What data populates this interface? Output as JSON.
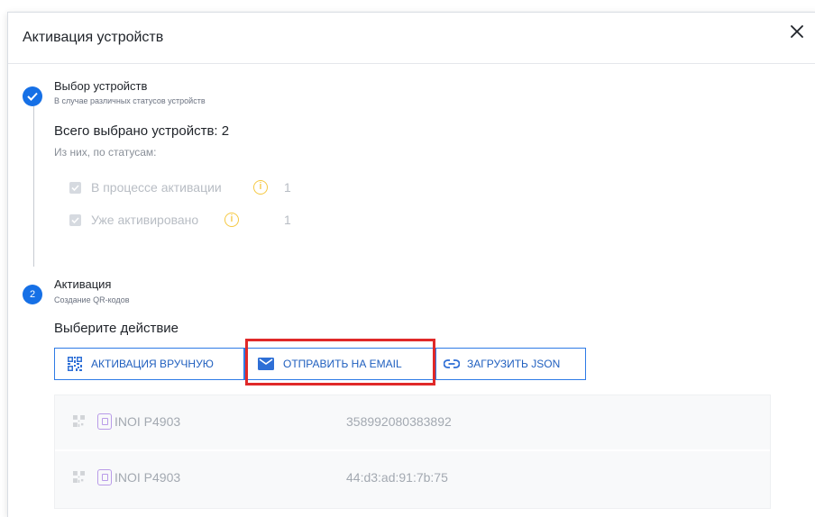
{
  "dialog": {
    "title": "Активация устройств",
    "close_icon": "close-icon"
  },
  "step1": {
    "title": "Выбор устройств",
    "subtitle": "В случае различных статусов устройств",
    "total": "Всего выбрано устройств: 2",
    "by_status": "Из них, по статусам:",
    "statuses": [
      {
        "label": "В процессе активации",
        "count": "1"
      },
      {
        "label": "Уже активировано",
        "count": "1"
      }
    ]
  },
  "step2": {
    "number": "2",
    "title": "Активация",
    "subtitle": "Создание QR-кодов",
    "choose": "Выберите действие",
    "actions": {
      "manual": "АКТИВАЦИЯ ВРУЧНУЮ",
      "email": "ОТПРАВИТЬ НА EMAIL",
      "json": "ЗАГРУЗИТЬ JSON"
    }
  },
  "devices": [
    {
      "name": "INOI P4903",
      "id": "358992080383892"
    },
    {
      "name": "INOI P4903",
      "id": "44:d3:ad:91:7b:75"
    }
  ],
  "colors": {
    "accent": "#1670e6",
    "highlight": "#e02929",
    "warning": "#f5c842"
  }
}
